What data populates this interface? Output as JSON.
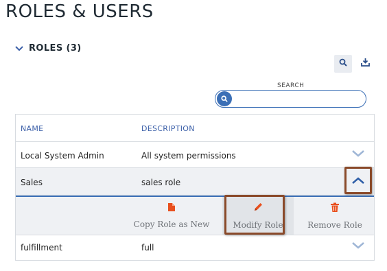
{
  "page": {
    "title": "ROLES & USERS"
  },
  "section": {
    "title": "ROLES (3)"
  },
  "toolbar": {
    "search_icon": "search-icon",
    "export_icon": "export-icon"
  },
  "search": {
    "label": "SEARCH",
    "value": "",
    "placeholder": ""
  },
  "table": {
    "columns": [
      "NAME",
      "DESCRIPTION"
    ],
    "rows": [
      {
        "name": "Local System Admin",
        "description": "All system permissions",
        "expanded": false
      },
      {
        "name": "Sales",
        "description": "sales role",
        "expanded": true
      },
      {
        "name": "fulfillment",
        "description": "full",
        "expanded": false
      }
    ]
  },
  "actions": {
    "copy_label": "Copy Role as New",
    "modify_label": "Modify Role",
    "remove_label": "Remove Role"
  },
  "colors": {
    "accent": "#3b6fb6",
    "icon_orange": "#e8501e",
    "highlight_border": "#8a4a2a",
    "row_expanded_bg": "#eff1f4"
  }
}
